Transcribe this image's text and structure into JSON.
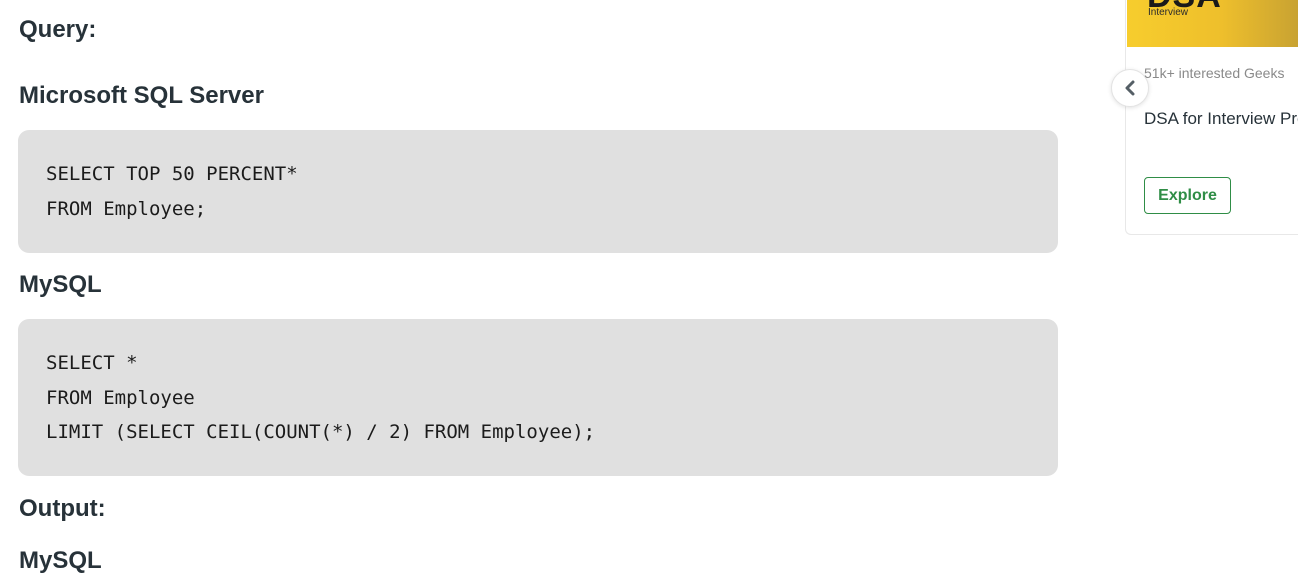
{
  "article": {
    "query_heading": "Query:",
    "mssql_heading": "Microsoft SQL Server",
    "mssql_code": [
      "SELECT TOP 50 PERCENT*",
      "FROM Employee;"
    ],
    "mysql_heading": "MySQL",
    "mysql_code": [
      "SELECT *",
      "FROM Employee",
      "LIMIT (SELECT CEIL(COUNT(*) / 2) FROM Employee);"
    ],
    "output_heading": "Output:",
    "output_mysql_heading": "MySQL"
  },
  "sidebar": {
    "banner_big_text": "DSA",
    "banner_small_text": "Interview",
    "interested_text": "51k+ interested Geeks",
    "course_title": "DSA for Interview Preparation",
    "explore_label": "Explore",
    "prev_icon": "chevron-left-icon",
    "accent_color": "#2f8d46",
    "banner_color": "#f7cd2d"
  }
}
